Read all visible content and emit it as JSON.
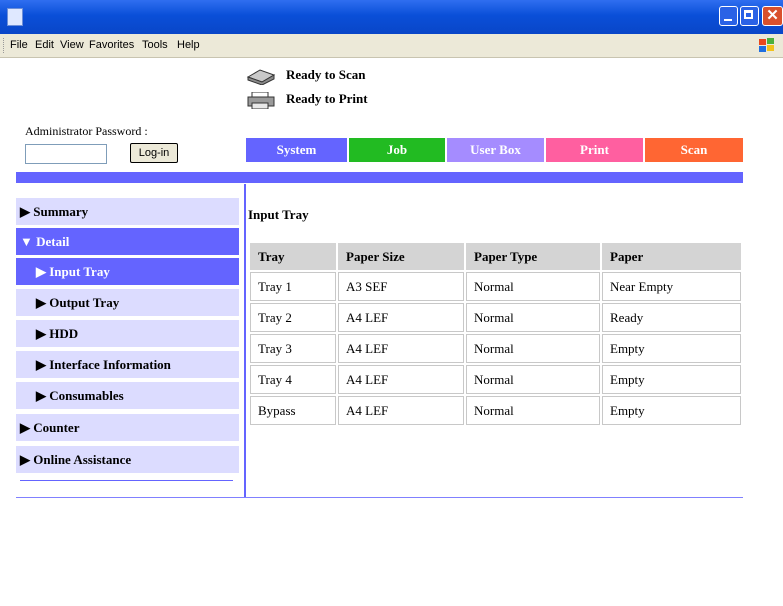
{
  "menu": [
    "File",
    "Edit",
    "View",
    "Favorites",
    "Tools",
    "Help"
  ],
  "status": {
    "scan": "Ready to Scan",
    "print": "Ready to Print"
  },
  "admin": {
    "label": "Administrator Password :",
    "password_value": "",
    "login_button": "Log-in"
  },
  "tabs": [
    {
      "label": "System",
      "color": "#6464ff"
    },
    {
      "label": "Job",
      "color": "#22bb22"
    },
    {
      "label": "User Box",
      "color": "#a58cff"
    },
    {
      "label": "Print",
      "color": "#ff5fa0"
    },
    {
      "label": "Scan",
      "color": "#ff6633"
    }
  ],
  "sidebar": {
    "items": [
      {
        "label": "Summary",
        "marker": "▶"
      },
      {
        "label": "Detail",
        "marker": "▼"
      },
      {
        "label": "Input Tray",
        "marker": "▶"
      },
      {
        "label": "Output Tray",
        "marker": "▶"
      },
      {
        "label": "HDD",
        "marker": "▶"
      },
      {
        "label": "Interface Information",
        "marker": "▶"
      },
      {
        "label": "Consumables",
        "marker": "▶"
      },
      {
        "label": "Counter",
        "marker": "▶"
      },
      {
        "label": "Online Assistance",
        "marker": "▶"
      }
    ]
  },
  "main": {
    "title": "Input Tray",
    "columns": [
      "Tray",
      "Paper Size",
      "Paper Type",
      "Paper"
    ],
    "rows": [
      [
        "Tray 1",
        "A3 SEF",
        "Normal",
        "Near Empty"
      ],
      [
        "Tray 2",
        "A4 LEF",
        "Normal",
        "Ready"
      ],
      [
        "Tray 3",
        "A4 LEF",
        "Normal",
        "Empty"
      ],
      [
        "Tray 4",
        "A4 LEF",
        "Normal",
        "Empty"
      ],
      [
        "Bypass",
        "A4 LEF",
        "Normal",
        "Empty"
      ]
    ]
  }
}
